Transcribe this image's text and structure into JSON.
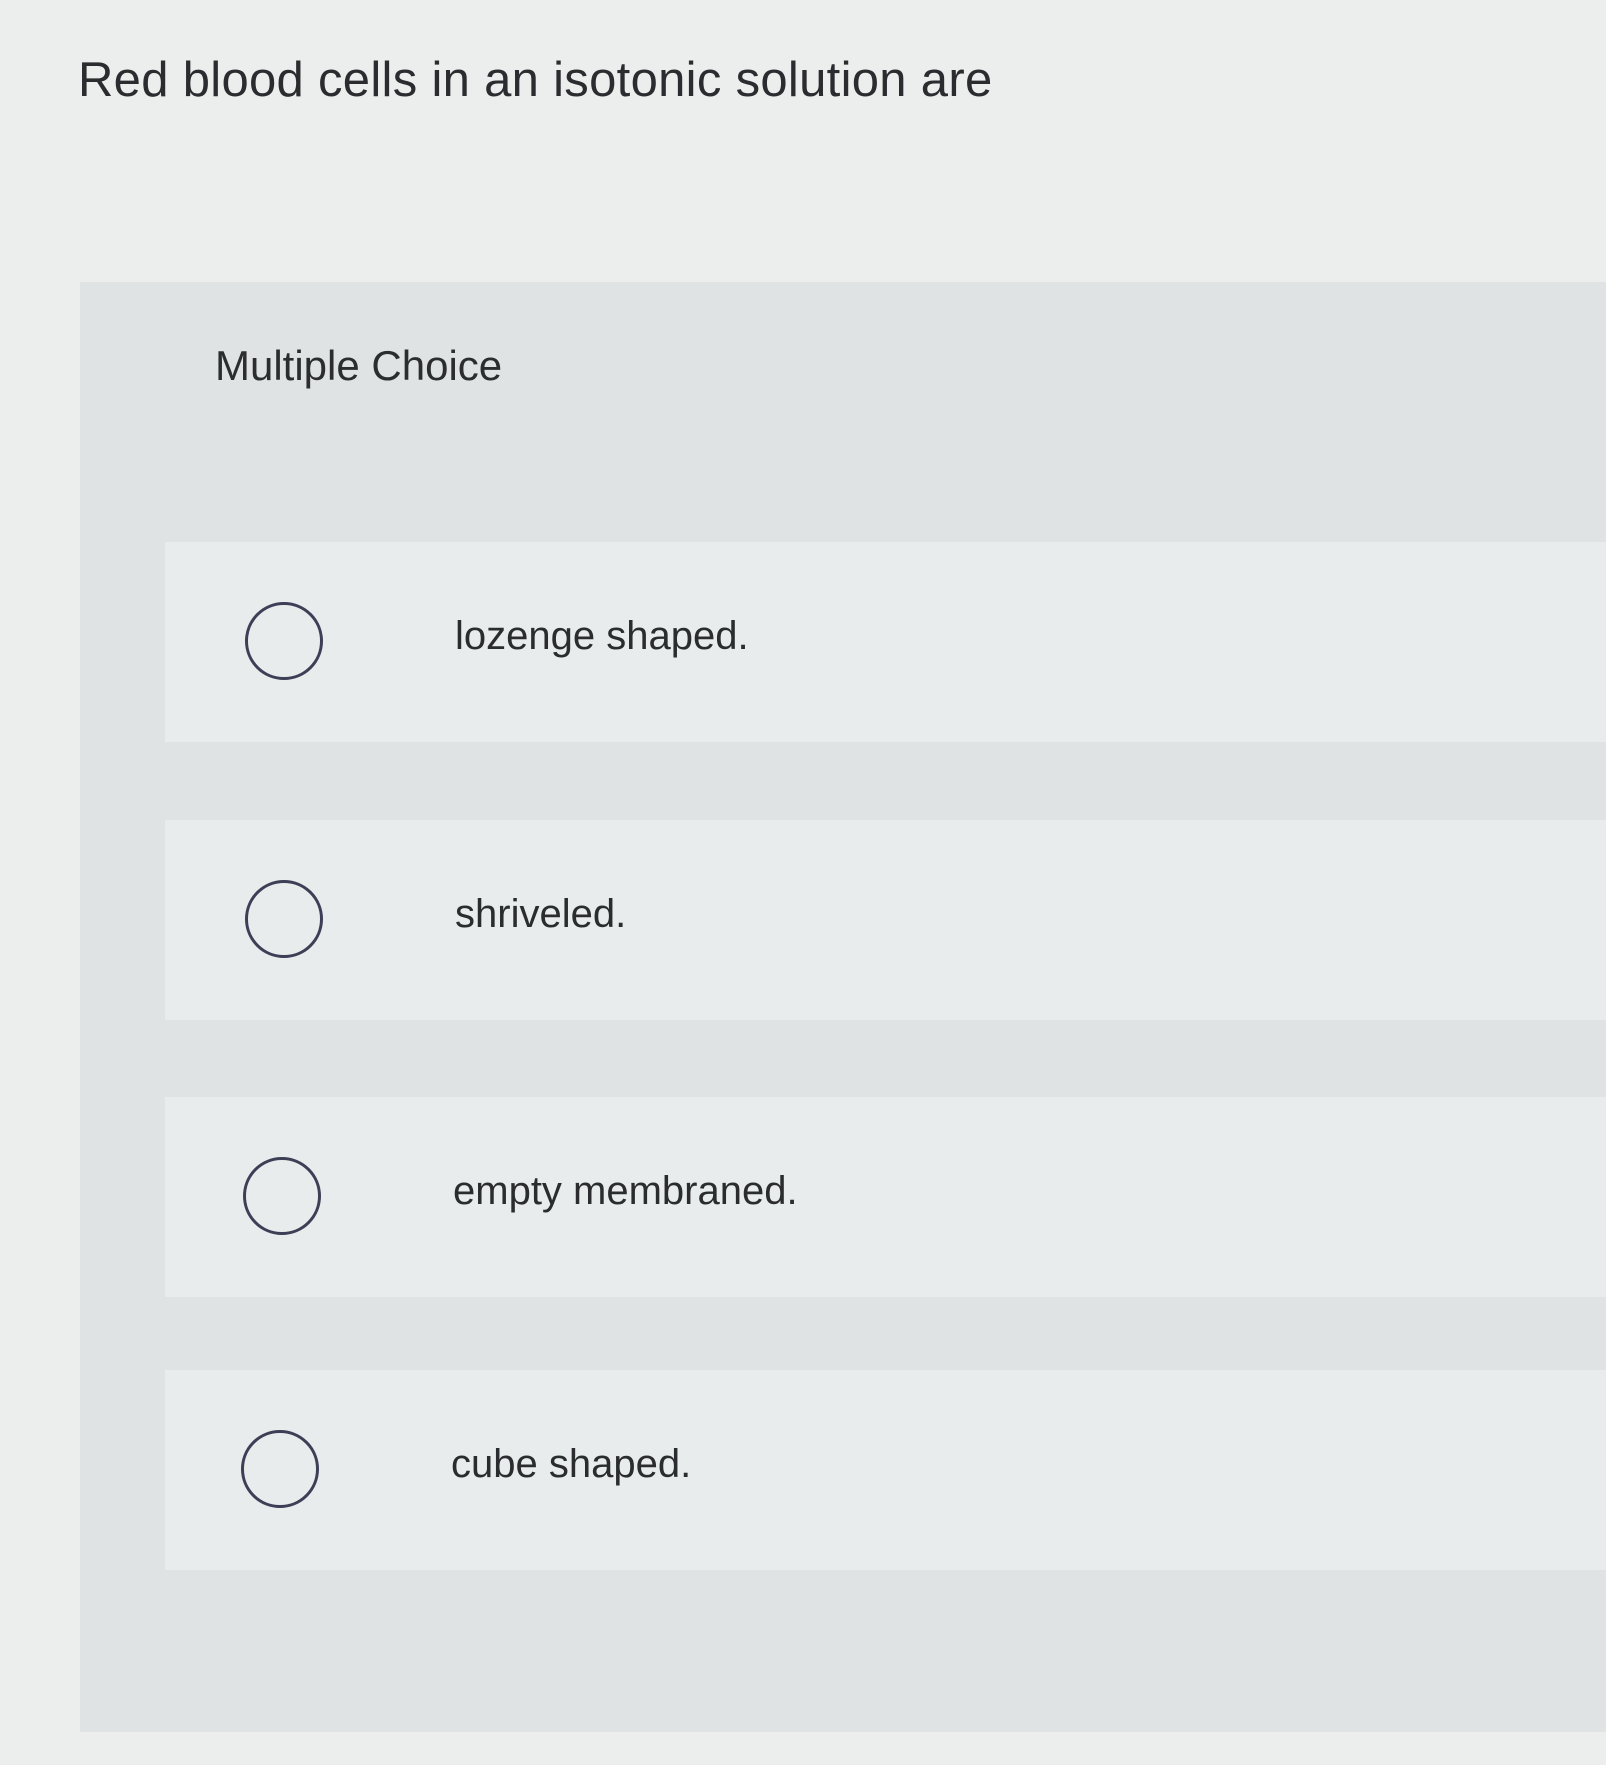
{
  "question": {
    "text": "Red blood cells in an isotonic solution are"
  },
  "panel": {
    "label": "Multiple Choice"
  },
  "options": [
    {
      "label": "lozenge shaped.",
      "selected": false
    },
    {
      "label": "shriveled.",
      "selected": false
    },
    {
      "label": "empty membraned.",
      "selected": false
    },
    {
      "label": "cube shaped.",
      "selected": false
    }
  ],
  "colors": {
    "background": "#eceeed",
    "panel": "#e0e3e3",
    "option_bg": "#e9ecec",
    "radio_border": "#3c3f55",
    "text": "#2a2c2f"
  }
}
